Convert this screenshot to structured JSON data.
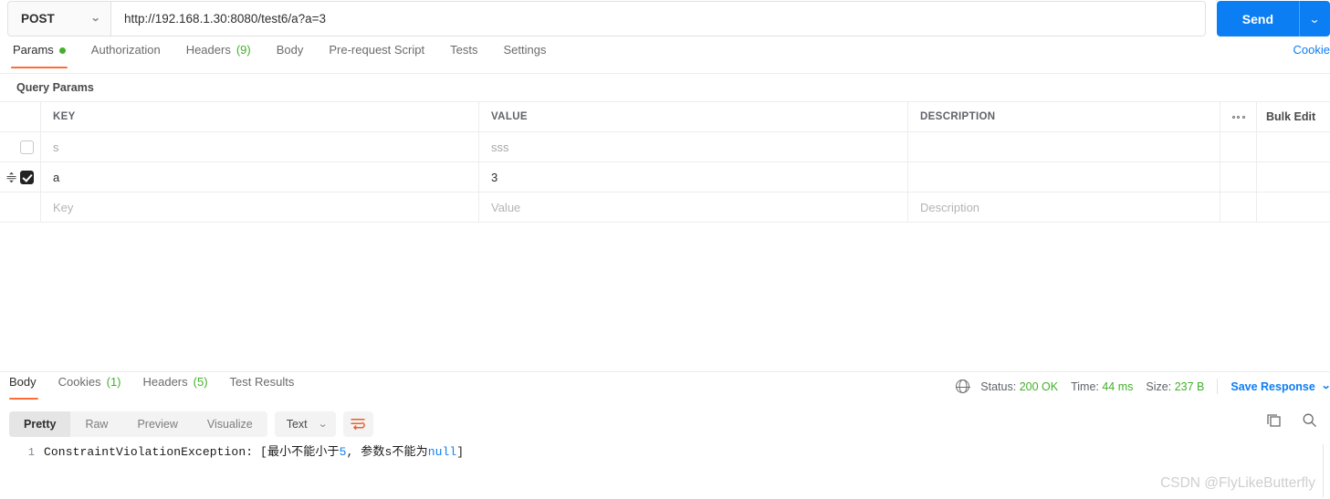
{
  "request": {
    "method": "POST",
    "url": "http://192.168.1.30:8080/test6/a?a=3",
    "send_label": "Send",
    "cookie_link": "Cookie"
  },
  "request_tabs": [
    {
      "label": "Params",
      "badge_dot": true,
      "active": true
    },
    {
      "label": "Authorization",
      "active": false
    },
    {
      "label": "Headers",
      "count": "(9)",
      "active": false
    },
    {
      "label": "Body",
      "active": false
    },
    {
      "label": "Pre-request Script",
      "active": false
    },
    {
      "label": "Tests",
      "active": false
    },
    {
      "label": "Settings",
      "active": false
    }
  ],
  "query_params": {
    "section_title": "Query Params",
    "columns": {
      "key": "KEY",
      "value": "VALUE",
      "description": "DESCRIPTION"
    },
    "bulk_edit_label": "Bulk Edit",
    "rows": [
      {
        "checked": false,
        "key": "s",
        "value": "sss",
        "description": "",
        "muted": true
      },
      {
        "checked": true,
        "key": "a",
        "value": "3",
        "description": "",
        "muted": false
      }
    ],
    "new_row": {
      "key": "Key",
      "value": "Value",
      "description": "Description"
    }
  },
  "response_tabs": [
    {
      "label": "Body",
      "active": true
    },
    {
      "label": "Cookies",
      "count": "(1)",
      "active": false
    },
    {
      "label": "Headers",
      "count": "(5)",
      "active": false
    },
    {
      "label": "Test Results",
      "active": false
    }
  ],
  "status": {
    "status_label": "Status:",
    "status_value": "200 OK",
    "time_label": "Time:",
    "time_value": "44 ms",
    "size_label": "Size:",
    "size_value": "237 B",
    "save_response": "Save Response"
  },
  "view_modes": [
    {
      "label": "Pretty",
      "active": true
    },
    {
      "label": "Raw",
      "active": false
    },
    {
      "label": "Preview",
      "active": false
    },
    {
      "label": "Visualize",
      "active": false
    }
  ],
  "format": {
    "selected": "Text"
  },
  "response_body": {
    "line_number": "1",
    "prefix": "ConstraintViolationException: ",
    "bracket_open": "[",
    "msg1_a": "最小不能小于",
    "msg1_num": "5",
    "comma": ", ",
    "msg2_a": "参数s不能为",
    "msg2_null": "null",
    "bracket_close": "]"
  },
  "watermark": "CSDN @FlyLikeButterfly",
  "colors": {
    "accent_orange": "#ff6c37",
    "blue": "#0b7ef4",
    "green": "#43b02a"
  }
}
